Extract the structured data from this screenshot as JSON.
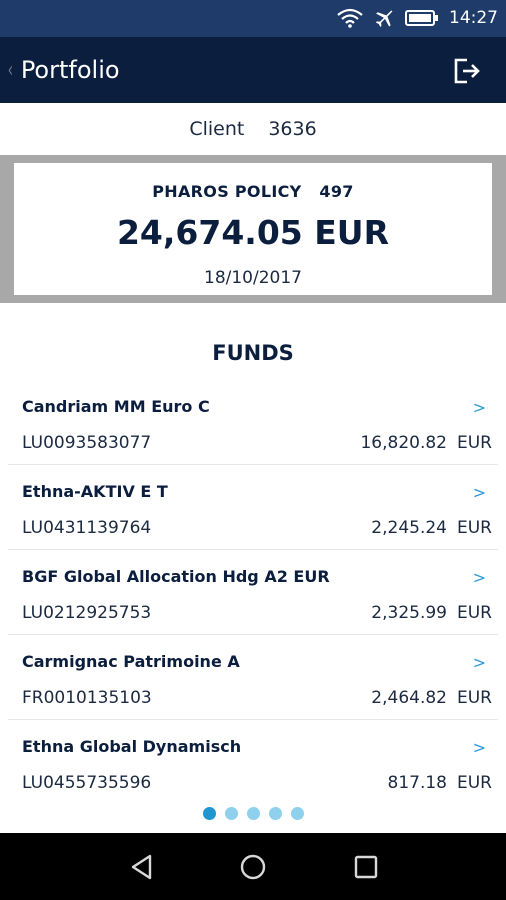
{
  "status_bar": {
    "time": "14:27",
    "icons": [
      "wifi-icon",
      "airplane-icon",
      "battery-icon"
    ]
  },
  "app_bar": {
    "back_chevron": "‹",
    "title": "Portfolio",
    "logout_icon": "logout-icon"
  },
  "client": {
    "label": "Client",
    "number": "3636"
  },
  "policy": {
    "name": "PHAROS POLICY",
    "number": "497",
    "value": "24,674.05 EUR",
    "date": "18/10/2017"
  },
  "funds": {
    "title": "FUNDS",
    "chevron": ">",
    "items": [
      {
        "name": "Candriam MM Euro C",
        "isin": "LU0093583077",
        "amount": "16,820.82",
        "currency": "EUR"
      },
      {
        "name": "Ethna-AKTIV E T",
        "isin": "LU0431139764",
        "amount": "2,245.24",
        "currency": "EUR"
      },
      {
        "name": "BGF Global Allocation Hdg A2 EUR",
        "isin": "LU0212925753",
        "amount": "2,325.99",
        "currency": "EUR"
      },
      {
        "name": "Carmignac Patrimoine A",
        "isin": "FR0010135103",
        "amount": "2,464.82",
        "currency": "EUR"
      },
      {
        "name": "Ethna Global Dynamisch",
        "isin": "LU0455735596",
        "amount": "817.18",
        "currency": "EUR"
      }
    ]
  },
  "pager": {
    "pages": 5,
    "active_index": 0
  },
  "colors": {
    "status_bar": "#1e3b6a",
    "app_bar": "#0b1e3d",
    "policy_band": "#a8a8a8",
    "accent": "#2a9ad6",
    "dot_active": "#1f95d2",
    "dot_inactive": "#8fd0ec"
  },
  "nav_bar": {
    "buttons": [
      "back-triangle-icon",
      "home-circle-icon",
      "recents-square-icon"
    ]
  }
}
